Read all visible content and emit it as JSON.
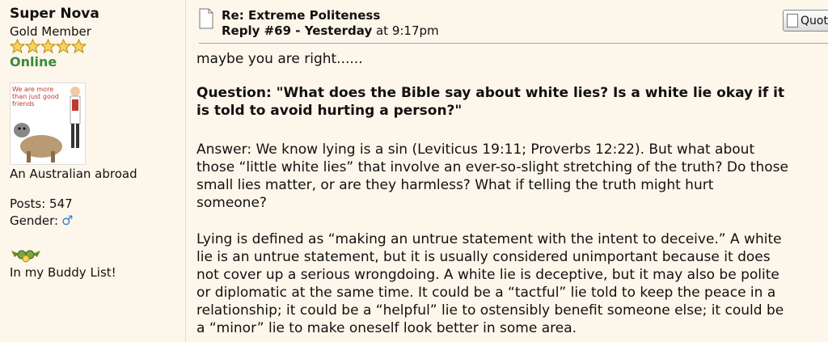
{
  "poster": {
    "name": "Super Nova",
    "rank": "Gold Member",
    "status": "Online",
    "avatar_caption": "We are more than just good friends",
    "location": "An Australian abroad",
    "posts": "Posts: 547",
    "gender_label": "Gender:",
    "buddy_text": "In my Buddy List!",
    "icons": [
      "star-icon",
      "avatar-image",
      "male-icon",
      "buddy-icon"
    ],
    "colors": {
      "online": "#3a8a3a",
      "male": "#2f7fc9"
    }
  },
  "post": {
    "title": "Re: Extreme Politeness",
    "reply": "Reply #69 - Yesterday",
    "time": " at 9:17pm",
    "quote_label": "Quote",
    "body": {
      "line1": "maybe you are right......",
      "question_line1": "Question: \"What does the Bible say about white lies? Is a white lie okay if it",
      "question_line2": "is told to avoid hurting a person?\"",
      "answer_line1": "Answer:  We know lying is a sin (Leviticus 19:11; Proverbs 12:22). But what about",
      "answer_line2": "those “little white lies” that involve an ever-so-slight stretching of the truth? Do those",
      "answer_line3": "small lies matter, or are they harmless? What if telling the truth might hurt",
      "answer_line4": "someone?",
      "lying_line1": "Lying is defined as “making an untrue statement with the intent to deceive.” A white",
      "lying_line2": "lie is an untrue statement, but it is usually considered unimportant because it does",
      "lying_line3": "not cover up a serious wrongdoing. A white lie is deceptive, but it may also be polite",
      "lying_line4": "or diplomatic at the same time. It could be a “tactful” lie told to keep the peace in a",
      "lying_line5": "relationship; it could be a “helpful” lie to ostensibly benefit someone else; it could be",
      "lying_line6": "a “minor” lie to make oneself look better in some area."
    }
  }
}
